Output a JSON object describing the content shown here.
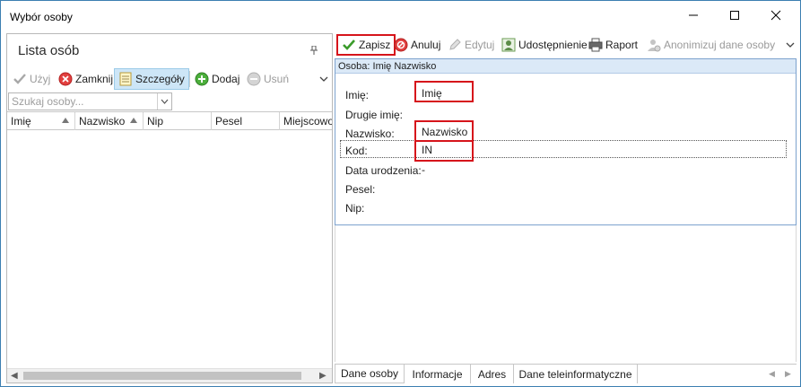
{
  "window": {
    "title": "Wybór osoby",
    "minimize_glyph": "—",
    "maximize_glyph": "☐",
    "close_glyph": "✕"
  },
  "left_panel": {
    "title": "Lista osób",
    "toolbar": {
      "use_label": "Użyj",
      "close_label": "Zamknij",
      "details_label": "Szczegóły",
      "add_label": "Dodaj",
      "delete_label": "Usuń"
    },
    "search": {
      "placeholder": "Szukaj osoby..."
    },
    "columns": [
      "Imię",
      "Nazwisko",
      "Nip",
      "Pesel",
      "Miejscowość"
    ]
  },
  "right_panel": {
    "toolbar": {
      "save_label": "Zapisz",
      "cancel_label": "Anuluj",
      "edit_label": "Edytuj",
      "share_label": "Udostępnienie",
      "report_label": "Raport",
      "anonymize_label": "Anonimizuj dane osoby"
    },
    "form": {
      "header": "Osoba: Imię  Nazwisko",
      "fields": {
        "first_name": {
          "label": "Imię:",
          "value": "Imię"
        },
        "second_name": {
          "label": "Drugie imię:",
          "value": ""
        },
        "last_name": {
          "label": "Nazwisko:",
          "value": "Nazwisko"
        },
        "code": {
          "label": "Kod:",
          "value": "IN"
        },
        "birth_date": {
          "label": "Data urodzenia:",
          "value": "-"
        },
        "pesel": {
          "label": "Pesel:",
          "value": ""
        },
        "nip": {
          "label": "Nip:",
          "value": ""
        }
      }
    },
    "tabs": [
      "Dane osoby",
      "Informacje",
      "Adres",
      "Dane teleinformatyczne"
    ]
  },
  "colors": {
    "highlight_red": "#d6141b",
    "window_border": "#3c7fb1",
    "form_header_bg": "#dbe9f7",
    "active_button_bg": "#cde6f7"
  },
  "icons": {
    "use": "checkmark-icon",
    "close": "close-circle-icon",
    "details": "notepad-icon",
    "add": "plus-circle-icon",
    "delete": "minus-circle-icon",
    "save": "green-checkmark-icon",
    "cancel": "cancel-circle-icon",
    "edit": "pencil-icon",
    "share": "share-person-icon",
    "report": "printer-icon",
    "anonymize": "anonymize-person-icon"
  }
}
